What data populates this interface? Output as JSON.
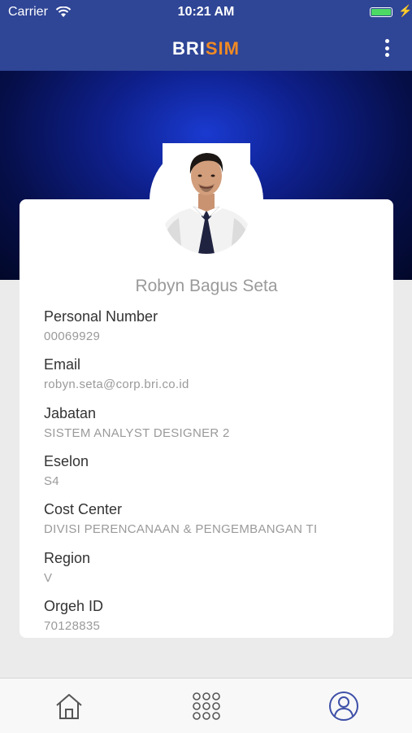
{
  "status_bar": {
    "carrier": "Carrier",
    "time": "10:21 AM"
  },
  "nav": {
    "logo_left": "BRI",
    "logo_right": "SIM"
  },
  "profile": {
    "name": "Robyn Bagus Seta",
    "fields": [
      {
        "label": "Personal Number",
        "value": "00069929"
      },
      {
        "label": "Email",
        "value": "robyn.seta@corp.bri.co.id"
      },
      {
        "label": "Jabatan",
        "value": "SISTEM ANALYST DESIGNER 2"
      },
      {
        "label": "Eselon",
        "value": "S4"
      },
      {
        "label": "Cost Center",
        "value": "DIVISI PERENCANAAN & PENGEMBANGAN TI"
      },
      {
        "label": "Region",
        "value": "V"
      },
      {
        "label": "Orgeh ID",
        "value": "70128835"
      }
    ]
  },
  "tabs": [
    {
      "icon": "home-icon"
    },
    {
      "icon": "apps-grid-icon"
    },
    {
      "icon": "profile-icon"
    }
  ],
  "colors": {
    "nav": "#2f4596",
    "accent": "#f08a24",
    "tab_active": "#3d4fa8"
  }
}
